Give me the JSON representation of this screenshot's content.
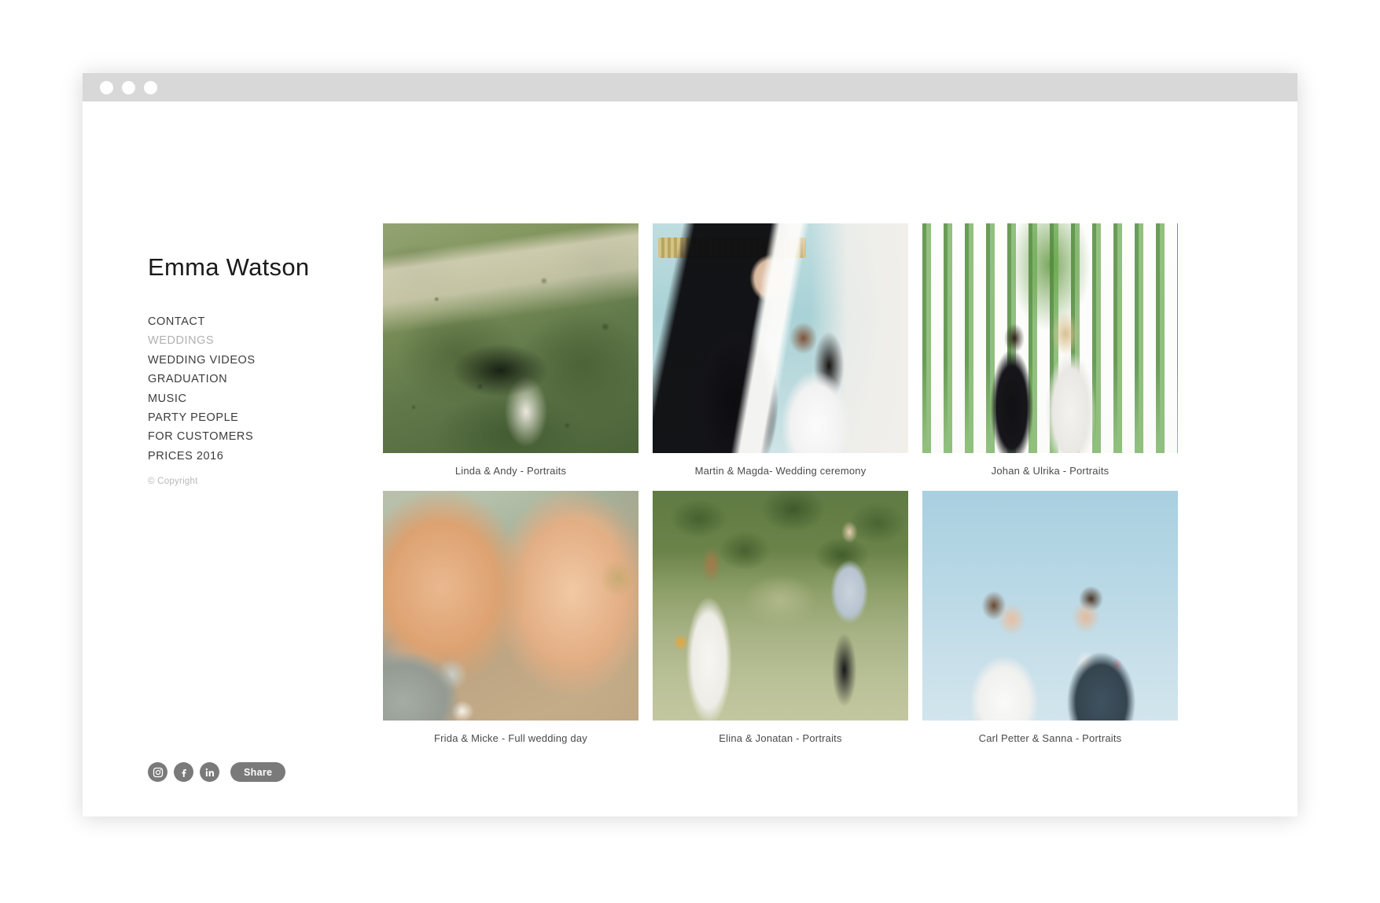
{
  "window": {
    "traffic_lights": [
      "close-dot",
      "minimize-dot",
      "maximize-dot"
    ]
  },
  "sidebar": {
    "site_title": "Emma Watson",
    "nav_items": [
      {
        "label": "CONTACT",
        "active": false
      },
      {
        "label": "WEDDINGS",
        "active": true
      },
      {
        "label": "WEDDING VIDEOS",
        "active": false
      },
      {
        "label": "GRADUATION",
        "active": false
      },
      {
        "label": "MUSIC",
        "active": false
      },
      {
        "label": "PARTY PEOPLE",
        "active": false
      },
      {
        "label": "FOR CUSTOMERS",
        "active": false
      },
      {
        "label": "PRICES 2016",
        "active": false
      }
    ],
    "copyright": "© Copyright",
    "social": [
      {
        "name": "instagram-icon"
      },
      {
        "name": "facebook-icon"
      },
      {
        "name": "linkedin-icon"
      }
    ],
    "share_label": "Share"
  },
  "gallery": {
    "items": [
      {
        "caption": "Linda & Andy - Portraits",
        "alt": "wedding couple embracing in green forest"
      },
      {
        "caption": "Martin & Magda- Wedding ceremony",
        "alt": "groom and bride laughing in teal ballroom"
      },
      {
        "caption": "Johan & Ulrika - Portraits",
        "alt": "couple standing among hanging green vines"
      },
      {
        "caption": "Frida & Micke - Full wedding day",
        "alt": "close-up portrait of couple forehead to forehead"
      },
      {
        "caption": "Elina & Jonatan - Portraits",
        "alt": "couple holding hands on grassy path"
      },
      {
        "caption": "Carl Petter & Sanna - Portraits",
        "alt": "couple laughing against blue sky"
      }
    ]
  },
  "colors": {
    "page_background": "#ffffff",
    "title_bar": "#d8d8d8",
    "nav_text": "#3c3c3c",
    "nav_active_text": "#b0b0b0",
    "caption_text": "#4a4a4a",
    "copyright_text": "#b8b8b8",
    "social_button": "#7a7a7a"
  }
}
